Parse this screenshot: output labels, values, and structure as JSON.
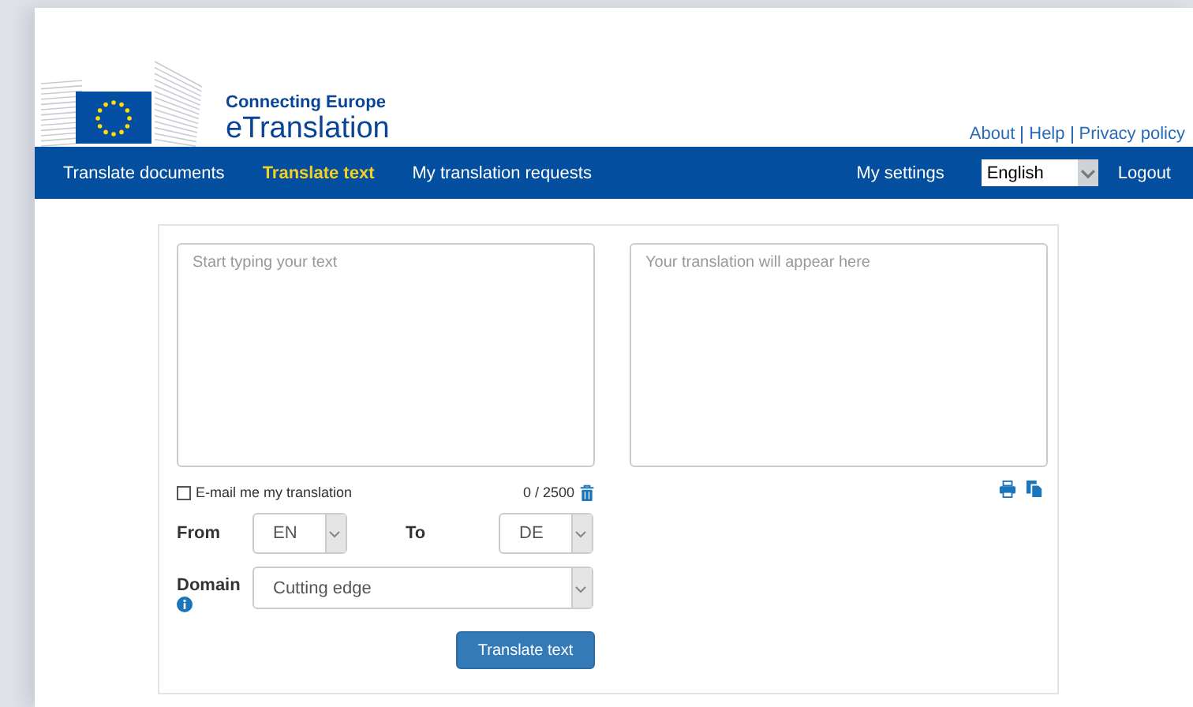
{
  "header": {
    "subtitle": "Connecting Europe",
    "title": "eTranslation",
    "links": [
      "About",
      "Help",
      "Privacy policy"
    ]
  },
  "nav": {
    "items": [
      {
        "label": "Translate documents",
        "selected": false
      },
      {
        "label": "Translate text",
        "selected": true
      },
      {
        "label": "My translation requests",
        "selected": false
      }
    ],
    "settings": "My settings",
    "language": "English",
    "logout": "Logout"
  },
  "source": {
    "placeholder": "Start typing your text",
    "counter": "0 / 2500"
  },
  "target": {
    "placeholder": "Your translation will appear here"
  },
  "email": {
    "label": "E-mail me my translation",
    "checked": false
  },
  "from": {
    "label": "From",
    "value": "EN"
  },
  "to": {
    "label": "To",
    "value": "DE"
  },
  "domain": {
    "label": "Domain",
    "value": "Cutting edge"
  },
  "submit": "Translate text"
}
